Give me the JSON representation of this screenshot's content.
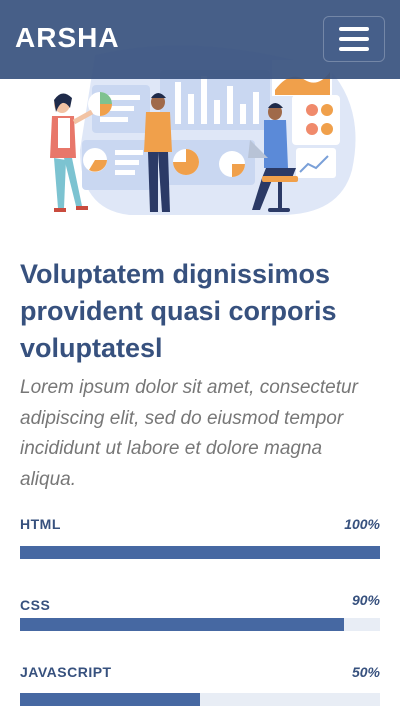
{
  "header": {
    "logo": "ARSHA",
    "menu_icon": "hamburger-menu-icon"
  },
  "hero": {
    "illustration": "team-analytics-illustration"
  },
  "content": {
    "title": "Voluptatem dignissimos provident quasi corporis voluptatesl",
    "intro": "Lorem ipsum dolor sit amet, consectetur adipiscing elit, sed do eiusmod tempor incididunt ut labore et dolore magna aliqua."
  },
  "skills": [
    {
      "name": "HTML",
      "value_label": "100%",
      "level": 1.0
    },
    {
      "name": "CSS",
      "value_label": "90%",
      "level": 0.9
    },
    {
      "name": "JAVASCRIPT",
      "value_label": "50%",
      "level": 0.5
    }
  ],
  "colors": {
    "brand": "#37517e",
    "bar": "#4668a2",
    "track": "#e8edf5",
    "accent_orange": "#f0a04b"
  }
}
